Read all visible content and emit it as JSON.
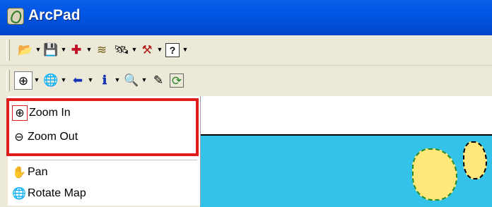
{
  "window": {
    "title": "ArcPad"
  },
  "toolbar_file": {
    "tools": [
      {
        "icon": "open-folder-icon",
        "glyph": "📂"
      },
      {
        "icon": "save-icon",
        "glyph": "💾"
      },
      {
        "icon": "add-data-icon",
        "glyph": "✚"
      },
      {
        "icon": "layers-icon",
        "glyph": "≋"
      },
      {
        "icon": "gps-icon",
        "glyph": "🛰"
      },
      {
        "icon": "tools-icon",
        "glyph": "⚒"
      },
      {
        "icon": "help-icon",
        "glyph": "?"
      }
    ]
  },
  "toolbar_browse": {
    "tools": [
      {
        "icon": "zoom-in-icon",
        "glyph": "⊕"
      },
      {
        "icon": "globe-icon",
        "glyph": "🌐"
      },
      {
        "icon": "back-arrow-icon",
        "glyph": "⬅"
      },
      {
        "icon": "identify-icon",
        "glyph": "ℹ"
      },
      {
        "icon": "find-binoculars-icon",
        "glyph": "🔍"
      },
      {
        "icon": "edit-pencil-icon",
        "glyph": "✎"
      },
      {
        "icon": "refresh-icon",
        "glyph": "⟳"
      }
    ]
  },
  "menu": {
    "items": [
      {
        "label": "Zoom In",
        "icon": "zoom-in-icon",
        "glyph": "⊕"
      },
      {
        "label": "Zoom Out",
        "icon": "zoom-out-icon",
        "glyph": "⊖"
      },
      {
        "label": "Pan",
        "icon": "pan-hand-icon",
        "glyph": "✋"
      },
      {
        "label": "Rotate Map",
        "icon": "rotate-map-icon",
        "glyph": "🌐"
      }
    ]
  },
  "colors": {
    "titlebar": "#0054e3",
    "highlight": "#e21b1b",
    "map_water": "#33c3e8"
  }
}
